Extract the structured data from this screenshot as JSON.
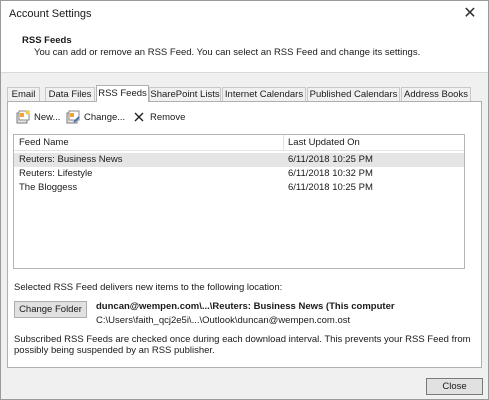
{
  "window": {
    "title": "Account Settings",
    "close_glyph": "✕"
  },
  "header": {
    "title": "RSS Feeds",
    "subtitle": "You can add or remove an RSS Feed. You can select an RSS Feed and change its settings."
  },
  "tabs": [
    {
      "label": "Email"
    },
    {
      "label": "Data Files"
    },
    {
      "label": "RSS Feeds",
      "active": true
    },
    {
      "label": "SharePoint Lists"
    },
    {
      "label": "Internet Calendars"
    },
    {
      "label": "Published Calendars"
    },
    {
      "label": "Address Books"
    }
  ],
  "toolbar": {
    "new_label": "New...",
    "change_label": "Change...",
    "remove_label": "Remove"
  },
  "list": {
    "columns": [
      "Feed Name",
      "Last Updated On"
    ],
    "rows": [
      {
        "name": "Reuters: Business News",
        "updated": "6/11/2018 10:25 PM",
        "selected": true
      },
      {
        "name": "Reuters: Lifestyle",
        "updated": "6/11/2018 10:32 PM"
      },
      {
        "name": "The Bloggess",
        "updated": "6/11/2018 10:25 PM"
      }
    ]
  },
  "location": {
    "label": "Selected RSS Feed delivers new items to the following location:",
    "change_folder_label": "Change Folder",
    "folder": "duncan@wempen.com\\...\\Reuters: Business News (This computer",
    "path": "C:\\Users\\faith_qcj2e5i\\...\\Outlook\\duncan@wempen.com.ost"
  },
  "note": "Subscribed RSS Feeds are checked once during each download interval. This prevents your RSS Feed from possibly being suspended by an RSS publisher.",
  "footer": {
    "close_label": "Close"
  }
}
